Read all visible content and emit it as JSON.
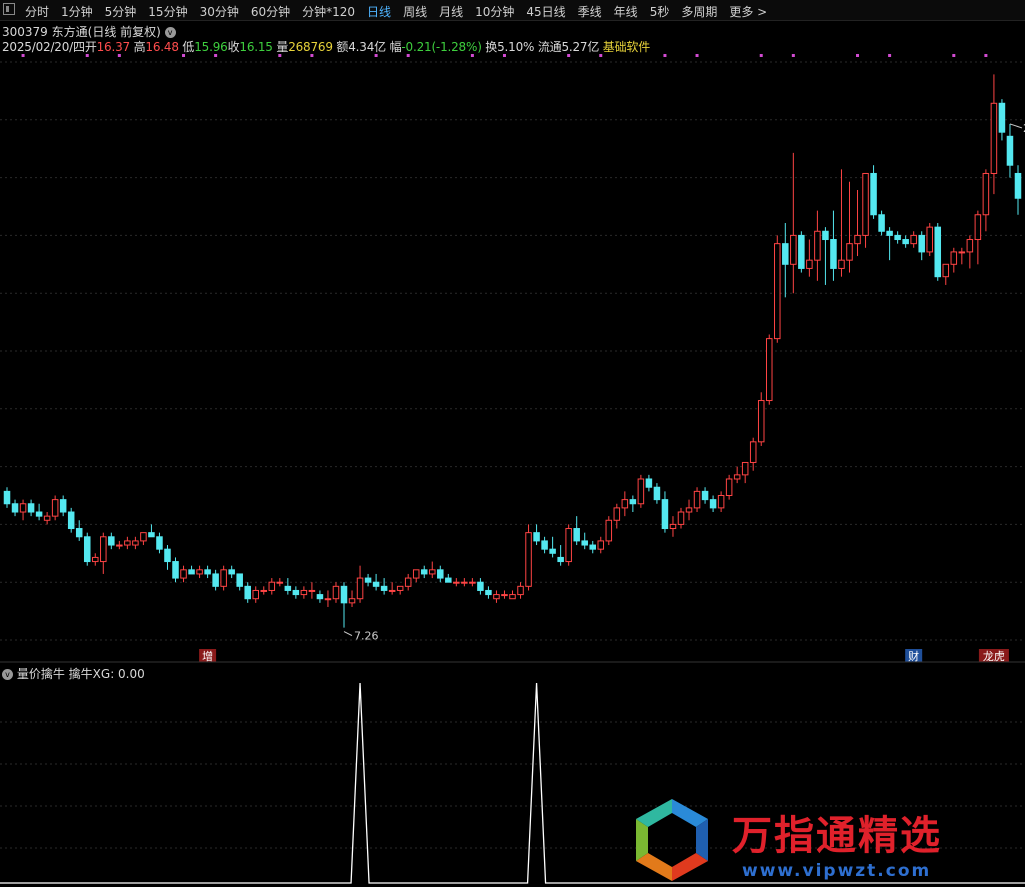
{
  "toolbar": {
    "tabs": [
      "分时",
      "1分钟",
      "5分钟",
      "15分钟",
      "30分钟",
      "60分钟",
      "分钟*120",
      "日线",
      "周线",
      "月线",
      "10分钟",
      "45日线",
      "季线",
      "年线",
      "5秒",
      "多周期",
      "更多 >"
    ],
    "active_tab": "日线"
  },
  "header": {
    "code": "300379",
    "name": "东方通",
    "mode": "(日线 前复权)",
    "date": "2025/02/20/四",
    "open_label": "开",
    "open": "16.37",
    "high_label": "高",
    "high": "16.48",
    "low_label": "低",
    "low": "15.96",
    "close_label": "收",
    "close": "16.15",
    "vol_label": "量",
    "vol": "268769",
    "amt_label": "额",
    "amt": "4.34亿",
    "chg_label": "幅",
    "chg": "-0.21(-1.28%)",
    "turnover": "换5.10%",
    "float_cap": "流通5.27亿",
    "sector": "基础软件"
  },
  "colors": {
    "up": "#ff4444",
    "down": "#54e8f0",
    "signal": "#ffffff",
    "marker": "#d24bd2",
    "grid": "#2a2a2a"
  },
  "chart_data": [
    {
      "type": "candlestick",
      "title": "300379 东方通 (日线 前复权)",
      "y_range": [
        7,
        21
      ],
      "annotations": [
        {
          "text": "7.26",
          "candle": 42,
          "kind": "low"
        },
        {
          "text": "2",
          "candle": 125,
          "kind": "high"
        },
        {
          "text": "增",
          "candle": 25,
          "kind": "event"
        },
        {
          "text": "财",
          "candle": 113,
          "kind": "event"
        },
        {
          "text": "龙虎",
          "candle": 123,
          "kind": "event"
        }
      ],
      "candles": [
        [
          10.6,
          10.7,
          10.2,
          10.3
        ],
        [
          10.3,
          10.4,
          10.0,
          10.1
        ],
        [
          10.1,
          10.4,
          9.9,
          10.3
        ],
        [
          10.3,
          10.4,
          10.0,
          10.1
        ],
        [
          10.1,
          10.3,
          9.9,
          10.0
        ],
        [
          9.9,
          10.1,
          9.8,
          10.0
        ],
        [
          10.0,
          10.5,
          9.9,
          10.4
        ],
        [
          10.4,
          10.5,
          10.0,
          10.1
        ],
        [
          10.1,
          10.2,
          9.6,
          9.7
        ],
        [
          9.7,
          9.9,
          9.4,
          9.5
        ],
        [
          9.5,
          9.6,
          8.8,
          8.9
        ],
        [
          8.9,
          9.1,
          8.8,
          9.0
        ],
        [
          8.9,
          9.6,
          8.6,
          9.5
        ],
        [
          9.5,
          9.6,
          9.2,
          9.3
        ],
        [
          9.3,
          9.4,
          9.2,
          9.3
        ],
        [
          9.3,
          9.5,
          9.2,
          9.4
        ],
        [
          9.3,
          9.5,
          9.2,
          9.4
        ],
        [
          9.4,
          9.6,
          9.3,
          9.6
        ],
        [
          9.6,
          9.8,
          9.5,
          9.5
        ],
        [
          9.5,
          9.6,
          9.1,
          9.2
        ],
        [
          9.2,
          9.3,
          8.7,
          8.9
        ],
        [
          8.9,
          9.0,
          8.4,
          8.5
        ],
        [
          8.5,
          8.8,
          8.4,
          8.7
        ],
        [
          8.7,
          8.8,
          8.6,
          8.6
        ],
        [
          8.6,
          8.8,
          8.5,
          8.7
        ],
        [
          8.7,
          8.8,
          8.5,
          8.6
        ],
        [
          8.6,
          8.7,
          8.2,
          8.3
        ],
        [
          8.3,
          8.8,
          8.2,
          8.7
        ],
        [
          8.7,
          8.8,
          8.5,
          8.6
        ],
        [
          8.6,
          8.6,
          8.2,
          8.3
        ],
        [
          8.3,
          8.4,
          7.9,
          8.0
        ],
        [
          8.0,
          8.3,
          7.9,
          8.2
        ],
        [
          8.2,
          8.3,
          8.1,
          8.2
        ],
        [
          8.2,
          8.5,
          8.1,
          8.4
        ],
        [
          8.4,
          8.5,
          8.3,
          8.4
        ],
        [
          8.3,
          8.5,
          8.1,
          8.2
        ],
        [
          8.2,
          8.3,
          8.0,
          8.1
        ],
        [
          8.1,
          8.3,
          8.0,
          8.2
        ],
        [
          8.2,
          8.4,
          8.0,
          8.2
        ],
        [
          8.1,
          8.2,
          7.9,
          8.0
        ],
        [
          8.0,
          8.2,
          7.8,
          8.0
        ],
        [
          8.0,
          8.4,
          7.9,
          8.3
        ],
        [
          8.3,
          8.4,
          7.3,
          7.9
        ],
        [
          7.9,
          8.2,
          7.8,
          8.0
        ],
        [
          8.0,
          8.8,
          7.9,
          8.5
        ],
        [
          8.5,
          8.6,
          8.3,
          8.4
        ],
        [
          8.4,
          8.6,
          8.2,
          8.3
        ],
        [
          8.3,
          8.5,
          8.1,
          8.2
        ],
        [
          8.2,
          8.4,
          8.1,
          8.2
        ],
        [
          8.2,
          8.3,
          8.1,
          8.3
        ],
        [
          8.3,
          8.6,
          8.2,
          8.5
        ],
        [
          8.5,
          8.7,
          8.4,
          8.7
        ],
        [
          8.7,
          8.8,
          8.5,
          8.6
        ],
        [
          8.6,
          8.9,
          8.5,
          8.7
        ],
        [
          8.7,
          8.8,
          8.4,
          8.5
        ],
        [
          8.5,
          8.6,
          8.4,
          8.4
        ],
        [
          8.4,
          8.5,
          8.3,
          8.4
        ],
        [
          8.4,
          8.5,
          8.3,
          8.4
        ],
        [
          8.4,
          8.5,
          8.3,
          8.4
        ],
        [
          8.4,
          8.5,
          8.1,
          8.2
        ],
        [
          8.2,
          8.3,
          8.0,
          8.1
        ],
        [
          8.0,
          8.2,
          7.9,
          8.1
        ],
        [
          8.1,
          8.2,
          8.0,
          8.1
        ],
        [
          8.0,
          8.2,
          8.0,
          8.1
        ],
        [
          8.1,
          8.4,
          8.0,
          8.3
        ],
        [
          8.3,
          9.8,
          8.2,
          9.6
        ],
        [
          9.6,
          9.8,
          9.3,
          9.4
        ],
        [
          9.4,
          9.5,
          9.1,
          9.2
        ],
        [
          9.2,
          9.5,
          9.0,
          9.1
        ],
        [
          9.0,
          9.3,
          8.8,
          8.9
        ],
        [
          8.9,
          9.8,
          8.8,
          9.7
        ],
        [
          9.7,
          10.0,
          9.3,
          9.4
        ],
        [
          9.4,
          9.6,
          9.2,
          9.3
        ],
        [
          9.3,
          9.4,
          9.1,
          9.2
        ],
        [
          9.2,
          9.5,
          9.1,
          9.4
        ],
        [
          9.4,
          10.0,
          9.3,
          9.9
        ],
        [
          9.9,
          10.3,
          9.7,
          10.2
        ],
        [
          10.2,
          10.6,
          10.0,
          10.4
        ],
        [
          10.4,
          10.5,
          10.1,
          10.3
        ],
        [
          10.3,
          11.0,
          10.2,
          10.9
        ],
        [
          10.9,
          11.0,
          10.6,
          10.7
        ],
        [
          10.7,
          10.8,
          10.3,
          10.4
        ],
        [
          10.4,
          10.6,
          9.6,
          9.7
        ],
        [
          9.7,
          10.0,
          9.5,
          9.8
        ],
        [
          9.8,
          10.2,
          9.7,
          10.1
        ],
        [
          10.1,
          10.4,
          9.9,
          10.2
        ],
        [
          10.2,
          10.7,
          10.1,
          10.6
        ],
        [
          10.6,
          10.7,
          10.3,
          10.4
        ],
        [
          10.4,
          10.5,
          10.1,
          10.2
        ],
        [
          10.2,
          10.6,
          10.1,
          10.5
        ],
        [
          10.5,
          11.0,
          10.4,
          10.9
        ],
        [
          10.9,
          11.2,
          10.8,
          11.0
        ],
        [
          11.0,
          11.3,
          10.8,
          11.3
        ],
        [
          11.3,
          11.9,
          11.1,
          11.8
        ],
        [
          11.8,
          13.0,
          11.7,
          12.8
        ],
        [
          12.8,
          14.4,
          12.7,
          14.3
        ],
        [
          14.3,
          16.8,
          14.2,
          16.6
        ],
        [
          16.6,
          17.1,
          15.3,
          16.1
        ],
        [
          16.1,
          18.8,
          15.4,
          16.8
        ],
        [
          16.8,
          16.9,
          15.9,
          16.0
        ],
        [
          16.0,
          16.7,
          15.8,
          16.2
        ],
        [
          16.2,
          17.4,
          15.7,
          16.9
        ],
        [
          16.9,
          17.0,
          15.6,
          16.7
        ],
        [
          16.7,
          17.4,
          15.7,
          16.0
        ],
        [
          16.0,
          18.4,
          15.8,
          16.2
        ],
        [
          16.2,
          18.1,
          15.9,
          16.6
        ],
        [
          16.6,
          17.9,
          16.3,
          16.8
        ],
        [
          16.8,
          18.3,
          16.5,
          18.3
        ],
        [
          18.3,
          18.5,
          17.2,
          17.3
        ],
        [
          17.3,
          17.4,
          16.8,
          16.9
        ],
        [
          16.9,
          17.0,
          16.2,
          16.8
        ],
        [
          16.8,
          16.9,
          16.6,
          16.7
        ],
        [
          16.7,
          16.8,
          16.5,
          16.6
        ],
        [
          16.6,
          16.9,
          16.5,
          16.8
        ],
        [
          16.8,
          16.9,
          16.2,
          16.4
        ],
        [
          16.4,
          17.1,
          16.3,
          17.0
        ],
        [
          17.0,
          17.1,
          15.7,
          15.8
        ],
        [
          15.8,
          16.1,
          15.6,
          16.1
        ],
        [
          16.1,
          16.5,
          15.9,
          16.4
        ],
        [
          16.4,
          16.5,
          16.1,
          16.4
        ],
        [
          16.4,
          16.8,
          16.0,
          16.7
        ],
        [
          16.7,
          17.4,
          16.1,
          17.3
        ],
        [
          17.3,
          18.4,
          16.9,
          18.3
        ],
        [
          18.3,
          20.7,
          17.8,
          20.0
        ],
        [
          20.0,
          20.1,
          19.1,
          19.3
        ],
        [
          19.2,
          19.5,
          18.2,
          18.5
        ],
        [
          18.3,
          18.5,
          17.3,
          17.7
        ]
      ]
    },
    {
      "type": "line",
      "title": "量价擒牛",
      "series": [
        {
          "name": "擒牛XG",
          "last_value": "0.00",
          "spikes_at_candle": [
            44,
            66
          ],
          "spike_value": 1
        }
      ]
    }
  ],
  "subpanel": {
    "indicator": "量价擒牛",
    "series_label": "擒牛XG: 0.00"
  },
  "watermark": {
    "title": "万指通精选",
    "url": "www.vipwzt.com"
  }
}
